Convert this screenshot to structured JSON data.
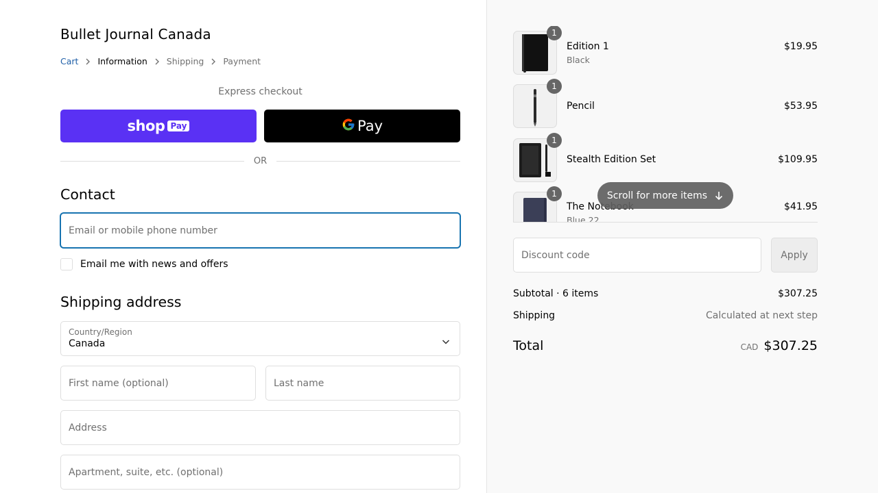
{
  "store": {
    "title": "Bullet Journal Canada"
  },
  "breadcrumb": [
    {
      "label": "Cart",
      "state": "link"
    },
    {
      "label": "Information",
      "state": "current"
    },
    {
      "label": "Shipping",
      "state": "disabled"
    },
    {
      "label": "Payment",
      "state": "disabled"
    }
  ],
  "express": {
    "label": "Express checkout",
    "shop_pay": {
      "word": "shop",
      "badge": "Pay"
    },
    "google_pay": {
      "word": "Pay"
    },
    "or_text": "OR"
  },
  "contact": {
    "heading": "Contact",
    "email_placeholder": "Email or mobile phone number",
    "news_checkbox_label": "Email me with news and offers",
    "news_checked": false
  },
  "shipping": {
    "heading": "Shipping address",
    "country_label": "Country/Region",
    "country_value": "Canada",
    "first_name_placeholder": "First name (optional)",
    "last_name_placeholder": "Last name",
    "address_placeholder": "Address",
    "apartment_placeholder": "Apartment, suite, etc. (optional)"
  },
  "cart": {
    "items": [
      {
        "name": "Edition 1",
        "variant": "Black",
        "price": "$19.95",
        "qty": "1",
        "thumb_icon": "black-notebook-icon"
      },
      {
        "name": "Pencil",
        "variant": "",
        "price": "$53.95",
        "qty": "1",
        "thumb_icon": "pencil-icon"
      },
      {
        "name": "Stealth Edition Set",
        "variant": "",
        "price": "$109.95",
        "qty": "1",
        "thumb_icon": "notebook-set-icon"
      },
      {
        "name": "The Notebook",
        "variant": "Blue 22",
        "price": "$41.95",
        "qty": "1",
        "thumb_icon": "blue-notebook-icon"
      }
    ],
    "scroll_hint": "Scroll for more items"
  },
  "discount": {
    "placeholder": "Discount code",
    "apply_label": "Apply"
  },
  "summary": {
    "subtotal_label": "Subtotal · 6 items",
    "subtotal_value": "$307.25",
    "shipping_label": "Shipping",
    "shipping_value": "Calculated at next step",
    "total_label": "Total",
    "currency": "CAD",
    "total_value": "$307.25"
  },
  "colors": {
    "shop_pay_purple": "#5a31f4",
    "google_pay_black": "#000000",
    "focus_blue": "#1773b0",
    "link_blue": "#1f5fa8",
    "summary_bg": "#f9f9f9"
  }
}
